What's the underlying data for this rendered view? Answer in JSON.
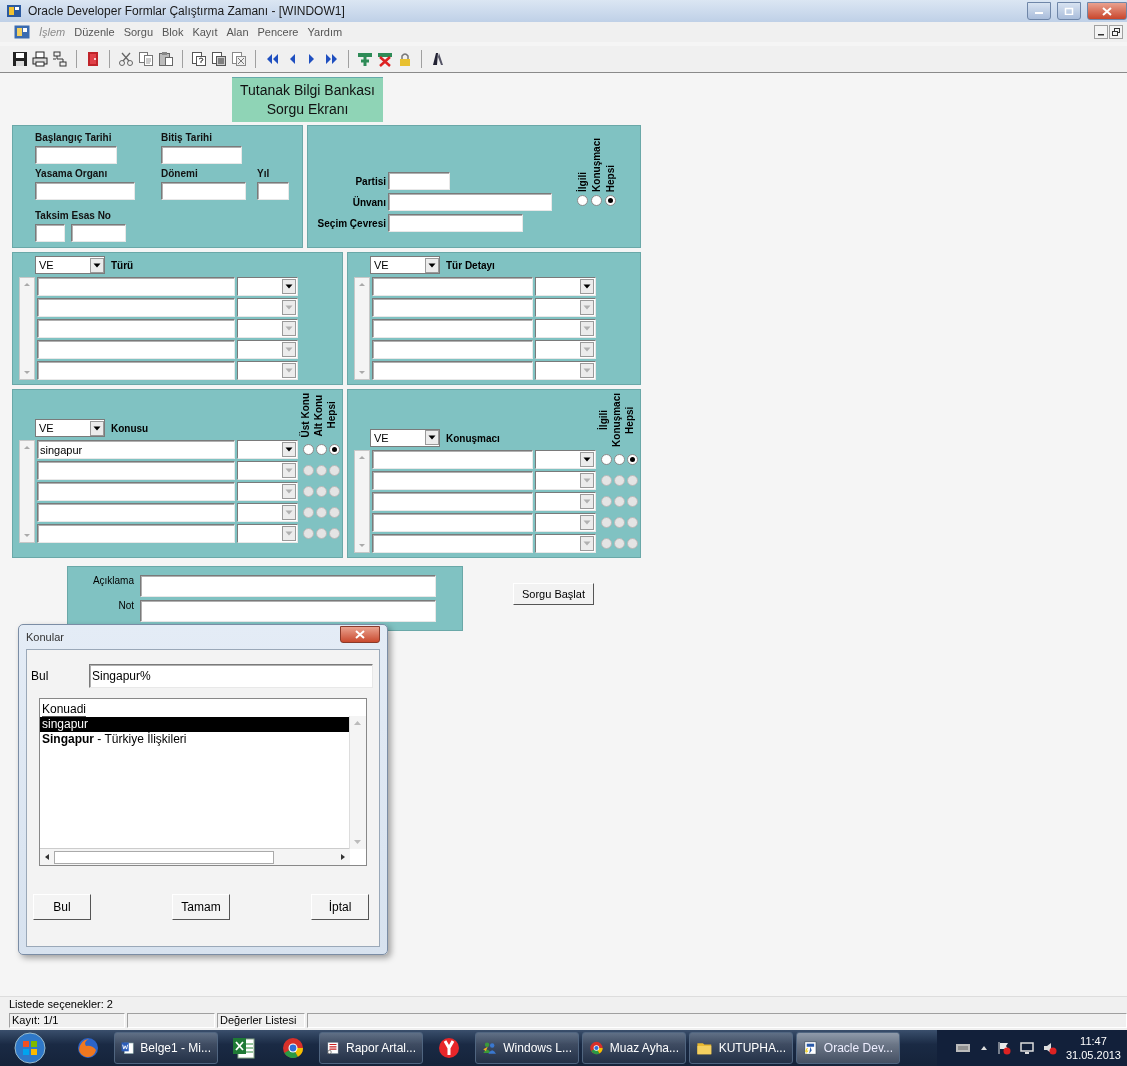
{
  "window": {
    "title": "Oracle Developer Formlar Çalıştırma Zamanı - [WINDOW1]"
  },
  "menu": [
    {
      "label": "İşlem",
      "disabled": true
    },
    {
      "label": "Düzenle",
      "disabled": false
    },
    {
      "label": "Sorgu",
      "disabled": false
    },
    {
      "label": "Blok",
      "disabled": false
    },
    {
      "label": "Kayıt",
      "disabled": false
    },
    {
      "label": "Alan",
      "disabled": false
    },
    {
      "label": "Pencere",
      "disabled": false
    },
    {
      "label": "Yardım",
      "disabled": false
    }
  ],
  "form_title": {
    "lines": [
      "Tutanak Bilgi Bankası",
      "Sorgu Ekranı"
    ]
  },
  "criteria": {
    "fields": [
      {
        "label": "Başlangıç Tarihi",
        "kind": "single"
      },
      {
        "label": "Bitiş Tarihi",
        "kind": "single"
      },
      {
        "label": "Yasama Organı",
        "kind": "single"
      },
      {
        "label": "Dönemi",
        "kind": "single"
      },
      {
        "label": "Yıl",
        "kind": "single"
      },
      {
        "label": "Taksim Esas No",
        "kind": "pair"
      }
    ],
    "person_fields": [
      {
        "label": "Partisi"
      },
      {
        "label": "Ünvanı"
      },
      {
        "label": "Seçim Çevresi"
      }
    ],
    "radios": [
      {
        "label": "İlgili",
        "selected": false
      },
      {
        "label": "Konuşmacı",
        "selected": false
      },
      {
        "label": "Hepsi",
        "selected": true
      }
    ]
  },
  "blocks": [
    {
      "operator": "VE",
      "title": "Türü",
      "rows": [
        {
          "enabled": true
        },
        {
          "enabled": false
        },
        {
          "enabled": false
        },
        {
          "enabled": false
        },
        {
          "enabled": false
        }
      ]
    },
    {
      "operator": "VE",
      "title": "Tür Detayı",
      "rows": [
        {
          "enabled": true
        },
        {
          "enabled": false
        },
        {
          "enabled": false
        },
        {
          "enabled": false
        },
        {
          "enabled": false
        }
      ]
    },
    {
      "operator": "VE",
      "title": "Konusu",
      "radio_labels": [
        "Üst Konu",
        "Alt Konu",
        "Hepsi"
      ],
      "rows": [
        {
          "value": "singapur",
          "enabled": true,
          "radios": [
            {
              "selected": false
            },
            {
              "selected": false
            },
            {
              "selected": true
            }
          ]
        },
        {
          "enabled": false,
          "radios": [
            {
              "selected": false
            },
            {
              "selected": false
            },
            {
              "selected": false
            }
          ]
        },
        {
          "enabled": false,
          "radios": [
            {
              "selected": false
            },
            {
              "selected": false
            },
            {
              "selected": false
            }
          ]
        },
        {
          "enabled": false,
          "radios": [
            {
              "selected": false
            },
            {
              "selected": false
            },
            {
              "selected": false
            }
          ]
        },
        {
          "enabled": false,
          "radios": [
            {
              "selected": false
            },
            {
              "selected": false
            },
            {
              "selected": false
            }
          ]
        }
      ]
    },
    {
      "operator": "VE",
      "title": "Konuşmacı",
      "radio_labels": [
        "İlgili",
        "Konuşmacı",
        "Hepsi"
      ],
      "rows": [
        {
          "enabled": true,
          "radios": [
            {
              "selected": false
            },
            {
              "selected": false
            },
            {
              "selected": true
            }
          ]
        },
        {
          "enabled": false,
          "radios": [
            {
              "selected": false
            },
            {
              "selected": false
            },
            {
              "selected": false
            }
          ]
        },
        {
          "enabled": false,
          "radios": [
            {
              "selected": false
            },
            {
              "selected": false
            },
            {
              "selected": false
            }
          ]
        },
        {
          "enabled": false,
          "radios": [
            {
              "selected": false
            },
            {
              "selected": false
            },
            {
              "selected": false
            }
          ]
        },
        {
          "enabled": false,
          "radios": [
            {
              "selected": false
            },
            {
              "selected": false
            },
            {
              "selected": false
            }
          ]
        }
      ]
    }
  ],
  "notes": {
    "fields": [
      {
        "label": "Açıklama"
      },
      {
        "label": "Not"
      }
    ]
  },
  "query_button": {
    "label": "Sorgu Başlat"
  },
  "dialog": {
    "title": "Konular",
    "search_label": "Bul",
    "search_value": "Singapur%",
    "list": {
      "header": "Konuadi",
      "items": [
        {
          "text": "singapur",
          "selected": true
        },
        {
          "text": "**Singapur** - Türkiye İlişkileri",
          "selected": false
        }
      ]
    },
    "buttons": [
      "Bul",
      "Tamam",
      "İptal"
    ]
  },
  "status": {
    "message": "Listede seçenekler: 2",
    "record": "Kayıt: 1/1",
    "mode": "Değerler Listesi"
  },
  "taskbar": {
    "items": [
      {
        "kind": "firefox",
        "selected": false
      },
      {
        "kind": "word",
        "label": "Belge1 - Mi...",
        "selected": false
      },
      {
        "kind": "excel",
        "selected": false
      },
      {
        "kind": "chrome",
        "selected": false
      },
      {
        "kind": "report",
        "label": "Rapor Artal...",
        "selected": false
      },
      {
        "kind": "yandex",
        "selected": false
      },
      {
        "kind": "messenger",
        "label": "Windows L...",
        "selected": false
      },
      {
        "kind": "chrome",
        "label": "Muaz Ayha...",
        "selected": false
      },
      {
        "kind": "folder",
        "label": "KUTUPHA...",
        "selected": false
      },
      {
        "kind": "oracle",
        "label": "Oracle Dev...",
        "selected": true
      }
    ],
    "time": "11:47",
    "date": "31.05.2013"
  }
}
